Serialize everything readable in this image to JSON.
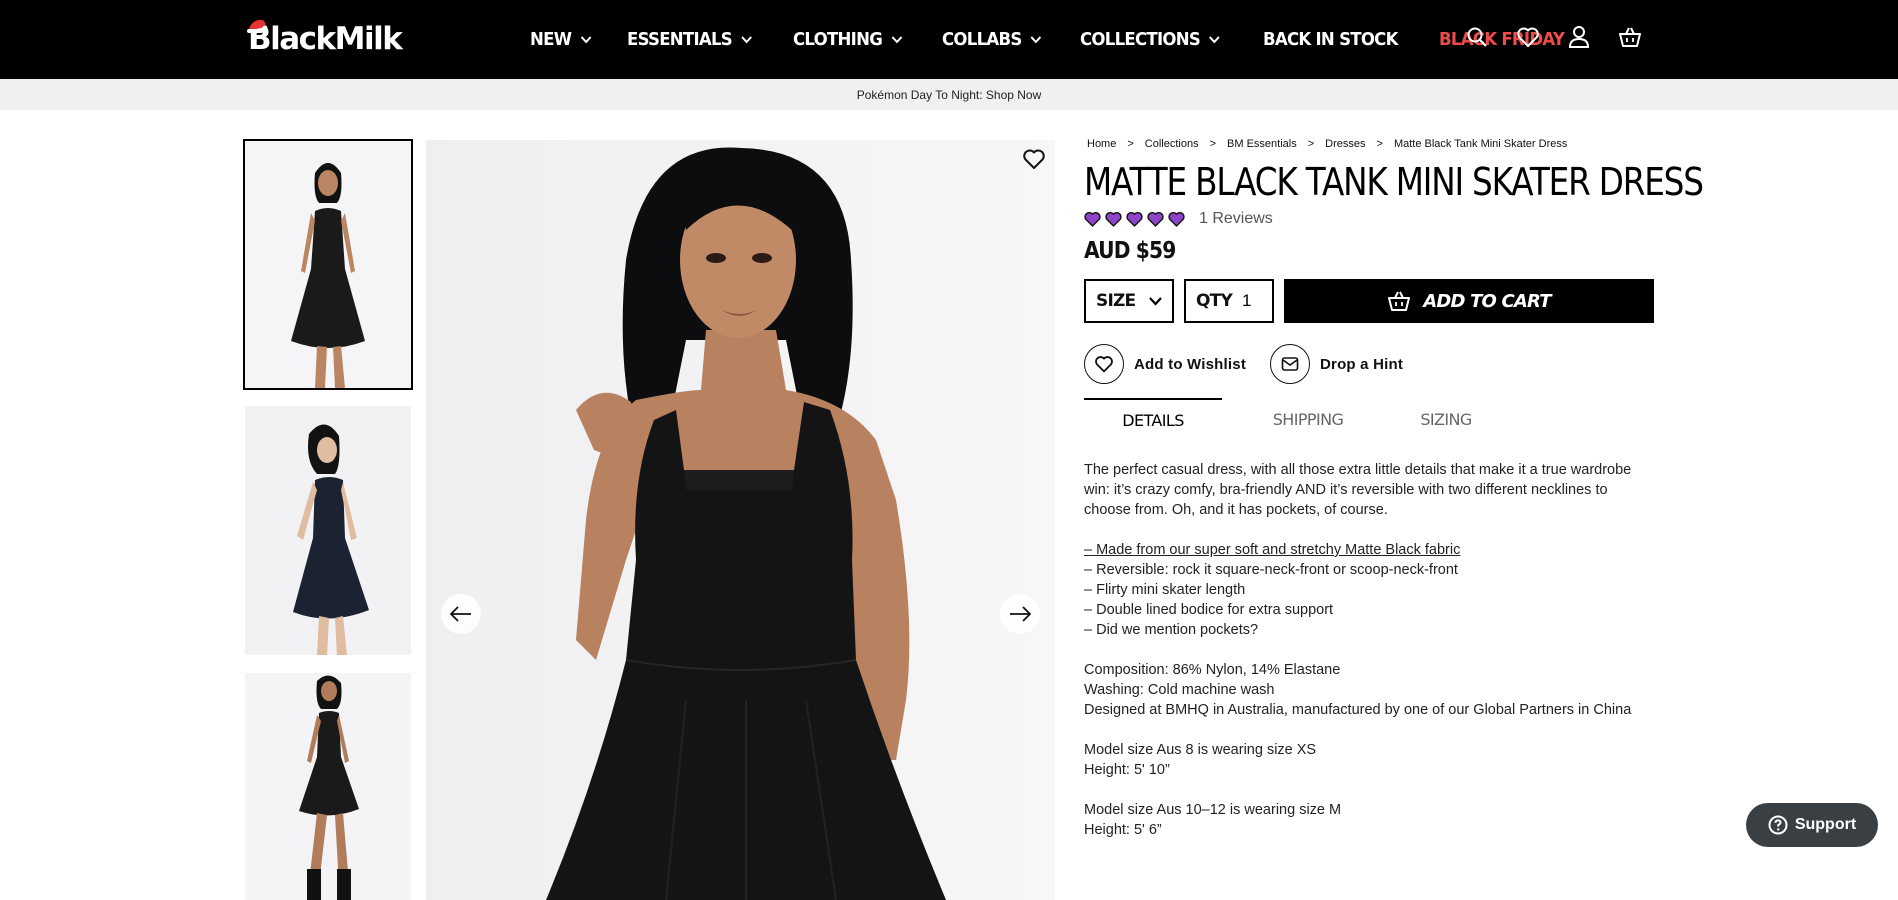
{
  "brand": {
    "logo_text": "BlackMilk"
  },
  "nav": {
    "items": [
      {
        "label": "NEW",
        "has_dropdown": true
      },
      {
        "label": "ESSENTIALS",
        "has_dropdown": true
      },
      {
        "label": "CLOTHING",
        "has_dropdown": true
      },
      {
        "label": "COLLABS",
        "has_dropdown": true
      },
      {
        "label": "COLLECTIONS",
        "has_dropdown": true
      },
      {
        "label": "BACK IN STOCK",
        "has_dropdown": false
      },
      {
        "label": "BLACK FRIDAY",
        "has_dropdown": false
      }
    ],
    "icons": [
      "search-icon",
      "heart-icon",
      "account-icon",
      "cart-icon"
    ],
    "sale_color": "#ef4b4b"
  },
  "promo": {
    "text": "Pokémon Day To Night: Shop Now"
  },
  "breadcrumb": [
    "Home",
    "Collections",
    "BM Essentials",
    "Dresses",
    "Matte Black Tank Mini Skater Dress"
  ],
  "breadcrumb_separator": ">",
  "product": {
    "title": "MATTE BLACK TANK MINI SKATER DRESS",
    "rating": 5,
    "rating_max": 5,
    "rating_color": "#8e44c9",
    "reviews_label": "1 Reviews",
    "price": "AUD $59",
    "size_label": "SIZE",
    "qty_label": "QTY",
    "qty_value": "1",
    "add_to_cart": "ADD TO CART",
    "wishlist_label": "Add to Wishlist",
    "hint_label": "Drop a Hint"
  },
  "tabs": [
    {
      "label": "DETAILS",
      "active": true
    },
    {
      "label": "SHIPPING",
      "active": false
    },
    {
      "label": "SIZING",
      "active": false
    }
  ],
  "details": {
    "intro": "The perfect casual dress, with all those extra little details that make it a true wardrobe win: it’s crazy comfy, bra-friendly AND it’s reversible with two different necklines to choose from. Oh, and it has pockets, of course.",
    "bullet_link": "– Made from our super soft and stretchy Matte Black fabric",
    "bullets": [
      "– Reversible: rock it square-neck-front or scoop-neck-front",
      "– Flirty mini skater length",
      "– Double lined bodice for extra support",
      "– Did we mention pockets?"
    ],
    "composition": "Composition: 86% Nylon, 14% Elastane",
    "washing": "Washing: Cold machine wash",
    "designed": "Designed at BMHQ in Australia, manufactured by one of our Global Partners in China",
    "model1_size": "Model size Aus 8 is wearing size XS",
    "model1_height": "Height: 5' 10”",
    "model2_size": "Model size Aus 10–12 is wearing size M",
    "model2_height": "Height: 5' 6”"
  },
  "support": {
    "label": "Support"
  }
}
